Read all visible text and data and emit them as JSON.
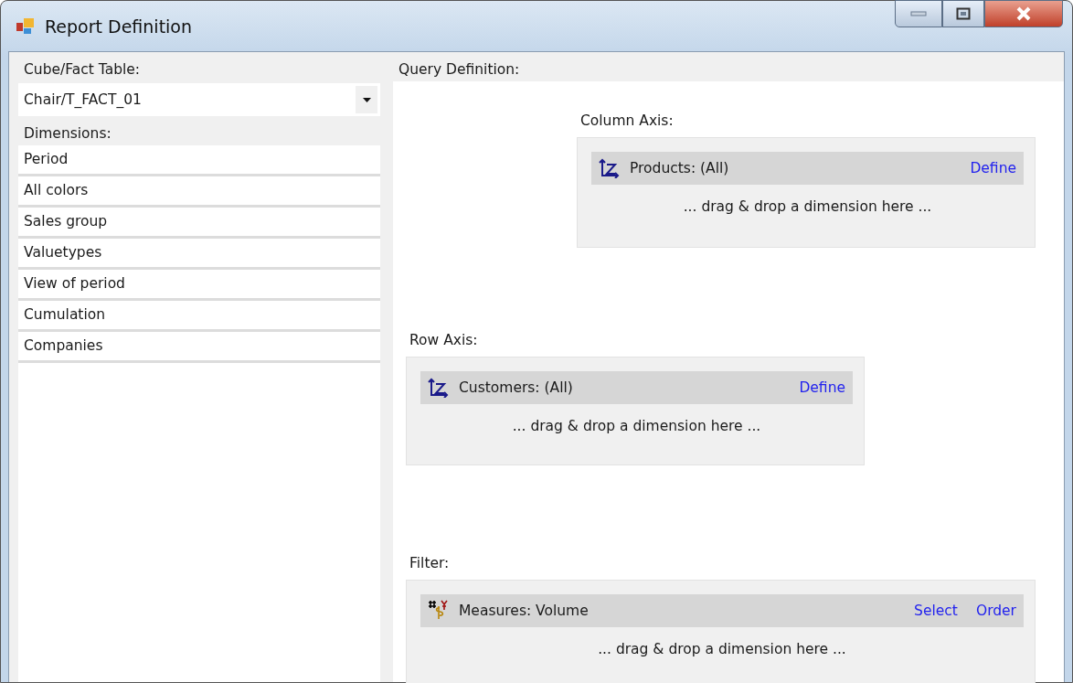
{
  "window": {
    "title": "Report Definition"
  },
  "cube": {
    "label": "Cube/Fact Table:",
    "value": "Chair/T_FACT_01"
  },
  "dimensions": {
    "label": "Dimensions:",
    "items": [
      "Period",
      "All colors",
      "Sales group",
      "Valuetypes",
      "View of period",
      "Cumulation",
      "Companies"
    ]
  },
  "query": {
    "label": "Query Definition:",
    "sections": [
      {
        "kind": "column",
        "label": "Column Axis:",
        "item": {
          "text": "Products: (All)",
          "links": [
            "Define"
          ]
        },
        "hint": "... drag & drop a dimension here ..."
      },
      {
        "kind": "row",
        "label": "Row Axis:",
        "item": {
          "text": "Customers: (All)",
          "links": [
            "Define"
          ]
        },
        "hint": "... drag & drop a dimension here ..."
      },
      {
        "kind": "filter",
        "label": "Filter:",
        "item": {
          "text": "Measures: Volume",
          "links": [
            "Select",
            "Order"
          ]
        },
        "hint": "... drag & drop a dimension here ..."
      }
    ]
  }
}
